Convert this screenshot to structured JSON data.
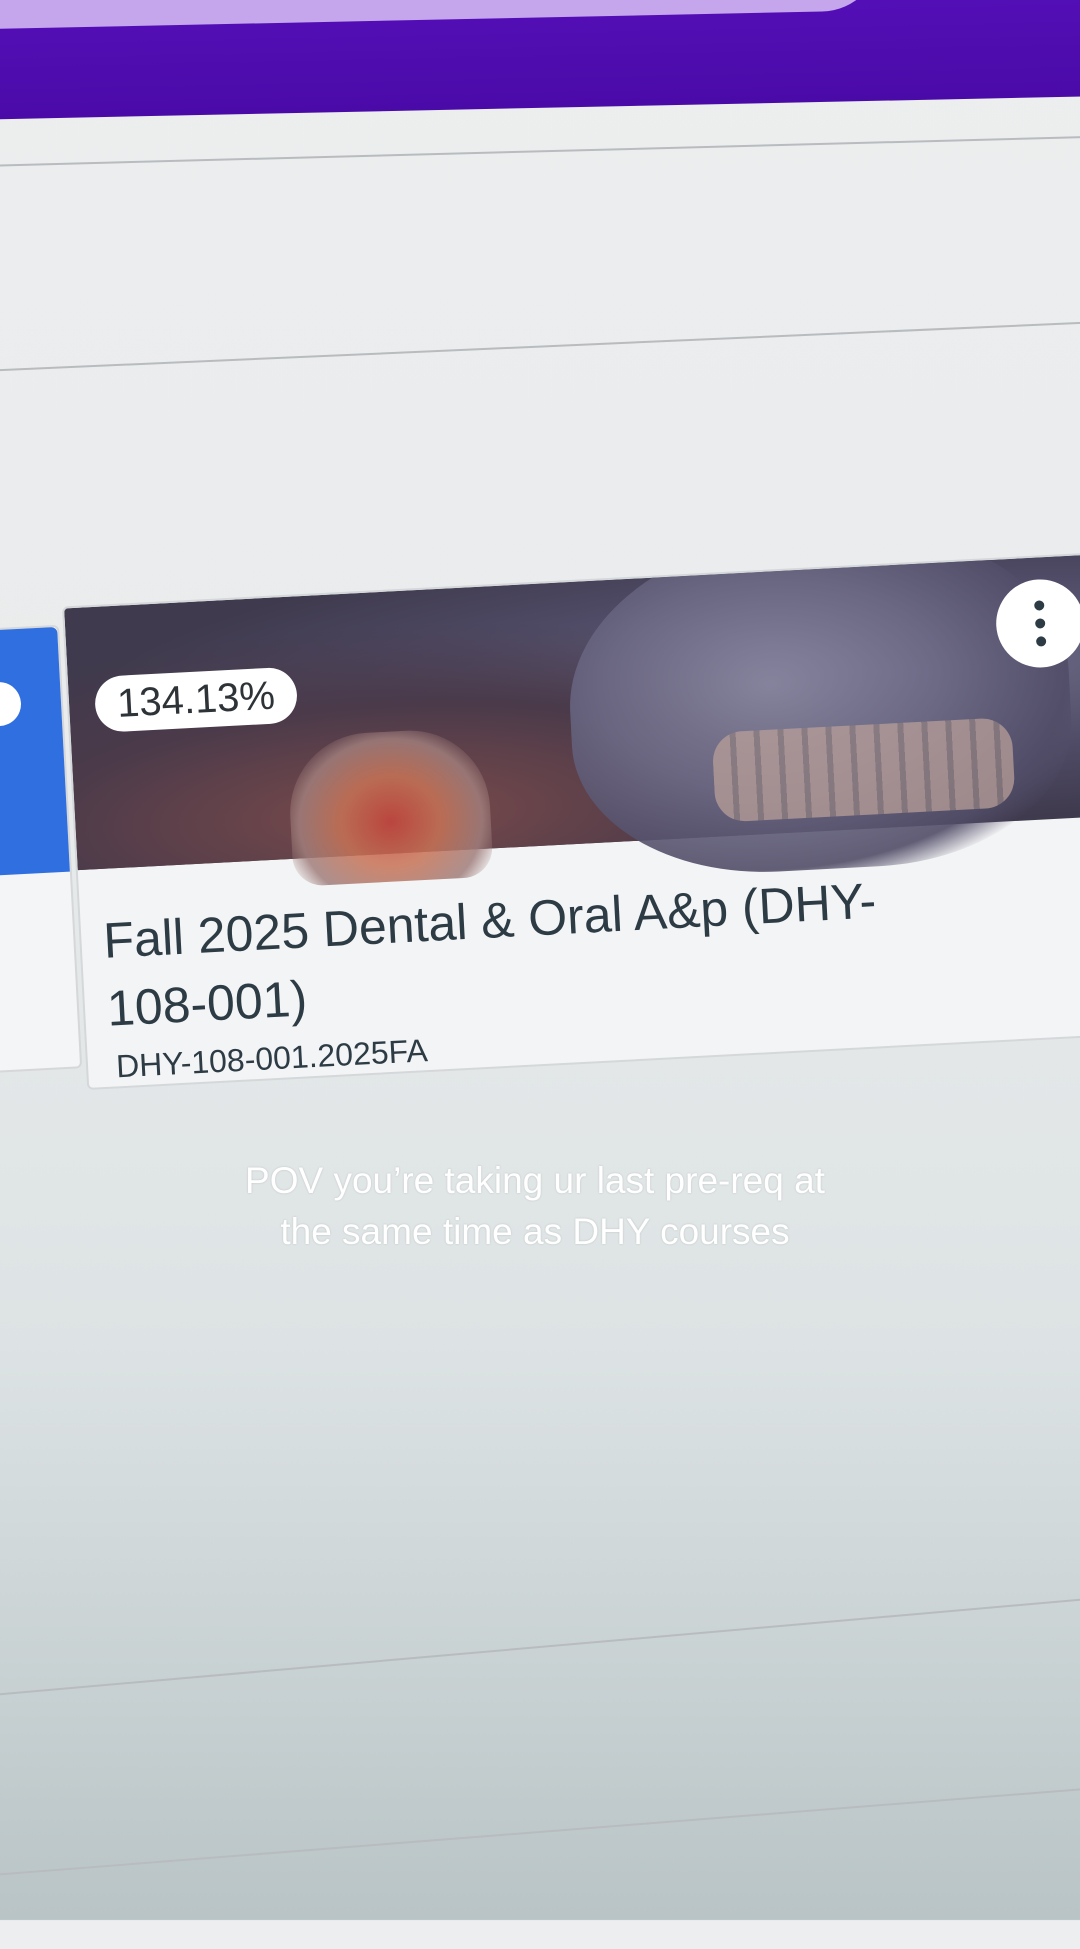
{
  "course_card": {
    "grade": "134.13%",
    "title": "Fall 2025 Dental & Oral A&p (DHY-108-001)",
    "code": "DHY-108-001.2025FA"
  },
  "caption": "POV you’re taking ur last pre-req at the same time as DHY courses",
  "colors": {
    "header": "#4a0aa8",
    "header_pill": "#c5a6ec",
    "side_card_accent": "#2f6fe0",
    "text": "#2d3b45"
  }
}
